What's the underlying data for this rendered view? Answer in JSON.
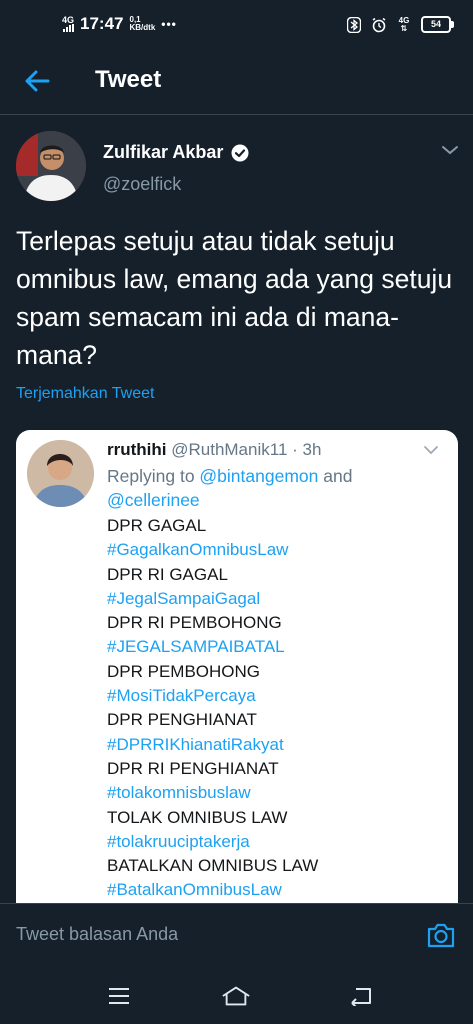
{
  "status_bar": {
    "network": "4G",
    "time": "17:47",
    "speed_value": "0,1",
    "speed_unit": "KB/dtk",
    "dots": "•••",
    "network_right": "4G",
    "battery": "54"
  },
  "header": {
    "title": "Tweet"
  },
  "tweet": {
    "author_name": "Zulfikar Akbar",
    "author_handle": "@zoelfick",
    "text": "Terlepas setuju atau tidak setuju omnibus law, emang ada yang setuju spam semacam ini ada di mana-mana?",
    "translate_label": "Terjemahkan Tweet"
  },
  "media": {
    "name": "rruthihi",
    "meta": "@RuthManik11 · 3h",
    "replying_prefix": "Replying to ",
    "reply_user_1": "@bintangemon",
    "reply_and": " and",
    "reply_user_2": "@cellerinee",
    "lines": [
      {
        "text": "DPR GAGAL",
        "kind": "plain"
      },
      {
        "text": "#GagalkanOmnibusLaw",
        "kind": "tag"
      },
      {
        "text": "DPR RI GAGAL",
        "kind": "plain"
      },
      {
        "text": "#JegalSampaiGagal",
        "kind": "tag"
      },
      {
        "text": "DPR RI PEMBOHONG",
        "kind": "plain"
      },
      {
        "text": "#JEGALSAMPAIBATAL",
        "kind": "tag"
      },
      {
        "text": "DPR PEMBOHONG",
        "kind": "plain"
      },
      {
        "text": "#MosiTidakPercaya",
        "kind": "tag"
      },
      {
        "text": "DPR PENGHIANAT",
        "kind": "plain"
      },
      {
        "text": "#DPRRIKhianatiRakyat",
        "kind": "tag"
      },
      {
        "text": "DPR RI PENGHIANAT",
        "kind": "plain"
      },
      {
        "text": "#tolakomnisbuslaw",
        "kind": "tag"
      },
      {
        "text": "TOLAK OMNIBUS LAW",
        "kind": "plain"
      },
      {
        "text": "#tolakruuciptakerja",
        "kind": "tag"
      },
      {
        "text": "BATALKAN OMNIBUS LAW",
        "kind": "plain"
      },
      {
        "text": "#BatalkanOmnibusLaw",
        "kind": "tag"
      }
    ]
  },
  "reply_bar": {
    "placeholder": "Tweet balasan Anda"
  },
  "icons": {
    "back": "arrow-left-icon",
    "verified": "verified-badge-icon",
    "caret": "chevron-down-icon",
    "camera": "camera-icon",
    "nav_menu": "menu-icon",
    "nav_home": "home-icon",
    "nav_back": "back-icon"
  },
  "colors": {
    "background": "#15202b",
    "accent": "#1da1f2",
    "secondary_text": "#8899a6",
    "divider": "#38444d"
  }
}
